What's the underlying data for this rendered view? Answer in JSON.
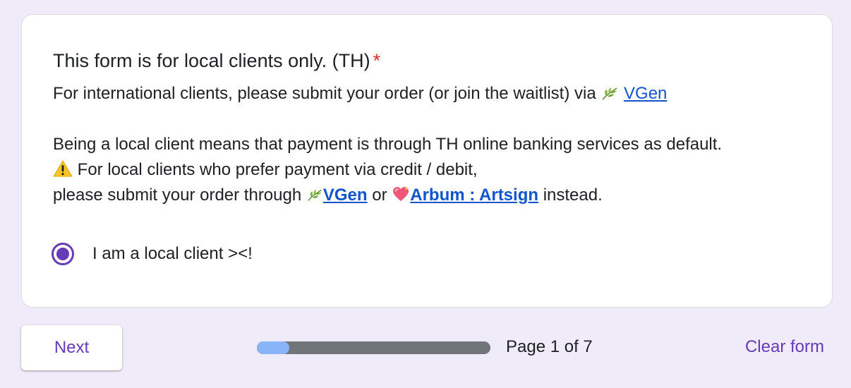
{
  "question": {
    "title": "This form is for local clients only. (TH)",
    "required_mark": "*"
  },
  "description": {
    "line1_text": "For international clients, please submit your order (or join the waitlist) via ",
    "line1_link": "VGen",
    "line2_text": "Being a local client means that payment is through TH online banking services as default.",
    "line3_text": " For local clients who prefer payment via credit / debit,",
    "line4_prefix": "please submit your order through ",
    "line4_link1": "VGen",
    "line4_middle": " or ",
    "line4_link2": "Arbum : Artsign",
    "line4_suffix": " instead."
  },
  "option": {
    "label": "I am a local client ><!",
    "selected": true
  },
  "footer": {
    "next_label": "Next",
    "page_indicator": "Page 1 of 7",
    "clear_label": "Clear form",
    "progress_fraction": 0.14
  },
  "icons": {
    "leaf": "leaf-icon",
    "warning": "warning-icon",
    "heart": "sparkling-heart-icon"
  },
  "colors": {
    "background": "#efebf8",
    "accent": "#673ab7",
    "link": "#1155cc",
    "required": "#d93025",
    "progress_fill": "#8ab4f8",
    "progress_track": "#70757a"
  }
}
